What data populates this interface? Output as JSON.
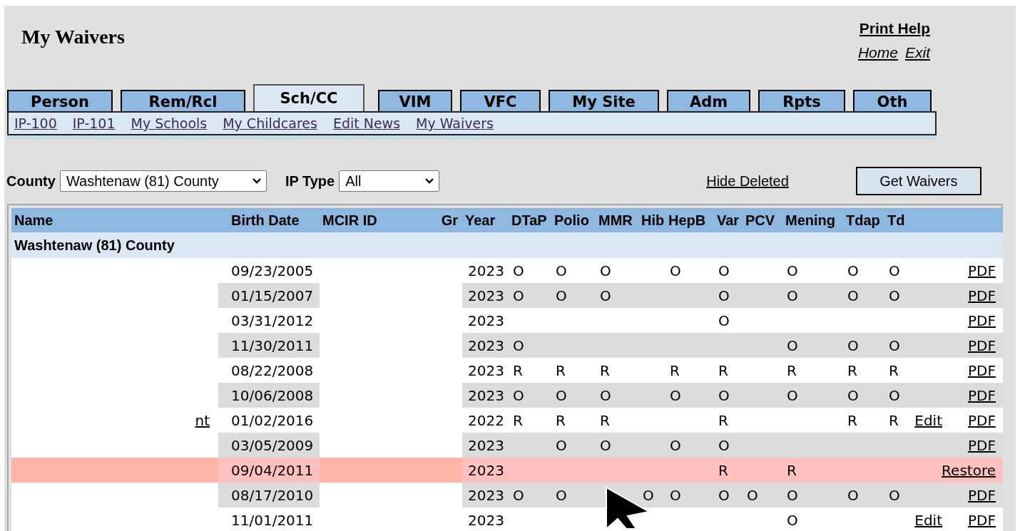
{
  "page_title": "My Waivers",
  "header_links": [
    {
      "label": "Print Help",
      "kind": "bold"
    },
    {
      "label": "Home",
      "kind": "italic"
    },
    {
      "label": "Exit",
      "kind": "italic"
    }
  ],
  "tabs": [
    {
      "label": "Person",
      "selected": false
    },
    {
      "label": "Rem/Rcl",
      "selected": false
    },
    {
      "label": "Sch/CC",
      "selected": true
    },
    {
      "label": "VIM",
      "selected": false
    },
    {
      "label": "VFC",
      "selected": false
    },
    {
      "label": "My Site",
      "selected": false
    },
    {
      "label": "Adm",
      "selected": false
    },
    {
      "label": "Rpts",
      "selected": false
    },
    {
      "label": "Oth",
      "selected": false
    }
  ],
  "subnav": [
    "IP-100",
    "IP-101",
    "My Schools",
    "My Childcares",
    "Edit News",
    "My Waivers"
  ],
  "filters": [
    {
      "label": "County",
      "value": "Washtenaw (81) County"
    },
    {
      "label": "IP Type",
      "value": "All"
    }
  ],
  "hide_deleted_link": "Hide Deleted",
  "get_button": "Get Waivers",
  "table": {
    "columns": [
      "Name",
      "Birth Date",
      "MCIR ID",
      "Gr",
      "Year",
      "DTaP",
      "Polio",
      "MMR",
      "Hib",
      "HepB",
      "Var",
      "PCV",
      "Mening",
      "Tdap",
      "Td"
    ],
    "group": "Washtenaw (81) County",
    "rows": [
      {
        "birth": "09/23/2005",
        "year": "2023",
        "deleted": false,
        "vaccines": {
          "dtap": "O",
          "polio": "O",
          "mmr": "O",
          "hepb": "O",
          "var": "O",
          "mening": "O",
          "tdap": "O",
          "td": "O"
        },
        "actions": [
          "PDF"
        ]
      },
      {
        "birth": "01/15/2007",
        "year": "2023",
        "deleted": false,
        "vaccines": {
          "dtap": "O",
          "polio": "O",
          "mmr": "O",
          "var": "O",
          "mening": "O",
          "tdap": "O",
          "td": "O"
        },
        "actions": [
          "PDF"
        ]
      },
      {
        "birth": "03/31/2012",
        "year": "2023",
        "deleted": false,
        "vaccines": {
          "var": "O"
        },
        "actions": [
          "PDF"
        ]
      },
      {
        "birth": "11/30/2011",
        "year": "2023",
        "deleted": false,
        "vaccines": {
          "dtap": "O",
          "mening": "O",
          "tdap": "O",
          "td": "O"
        },
        "actions": [
          "PDF"
        ]
      },
      {
        "birth": "08/22/2008",
        "year": "2023",
        "deleted": false,
        "vaccines": {
          "dtap": "R",
          "polio": "R",
          "mmr": "R",
          "hepb": "R",
          "var": "R",
          "mening": "R",
          "tdap": "R",
          "td": "R"
        },
        "actions": [
          "PDF"
        ]
      },
      {
        "birth": "10/06/2008",
        "year": "2023",
        "deleted": false,
        "vaccines": {
          "dtap": "O",
          "polio": "O",
          "mmr": "O",
          "hepb": "O",
          "var": "O",
          "mening": "O",
          "tdap": "O",
          "td": "O"
        },
        "actions": [
          "PDF"
        ]
      },
      {
        "name": "nt",
        "birth": "01/02/2016",
        "year": "2022",
        "deleted": false,
        "vaccines": {
          "dtap": "R",
          "polio": "R",
          "mmr": "R",
          "var": "R",
          "tdap": "R",
          "td": "R"
        },
        "actions": [
          "Edit",
          "PDF"
        ]
      },
      {
        "birth": "03/05/2009",
        "year": "2023",
        "deleted": false,
        "vaccines": {
          "polio": "O",
          "mmr": "O",
          "hepb": "O",
          "var": "O"
        },
        "actions": [
          "PDF"
        ]
      },
      {
        "birth": "09/04/2011",
        "year": "2023",
        "deleted": true,
        "vaccines": {
          "var": "R",
          "mening": "R"
        },
        "actions": [
          "Restore"
        ]
      },
      {
        "birth": "08/17/2010",
        "year": "2023",
        "deleted": false,
        "vaccines": {
          "dtap": "O",
          "polio": "O",
          "hib": "O",
          "hepb": "O",
          "var": "O",
          "pcv": "O",
          "mening": "O",
          "tdap": "O",
          "td": "O"
        },
        "actions": [
          "PDF"
        ]
      },
      {
        "birth": "11/01/2011",
        "year": "2023",
        "deleted": false,
        "vaccines": {
          "mening": "O"
        },
        "actions": [
          "Edit",
          "PDF"
        ]
      }
    ]
  }
}
